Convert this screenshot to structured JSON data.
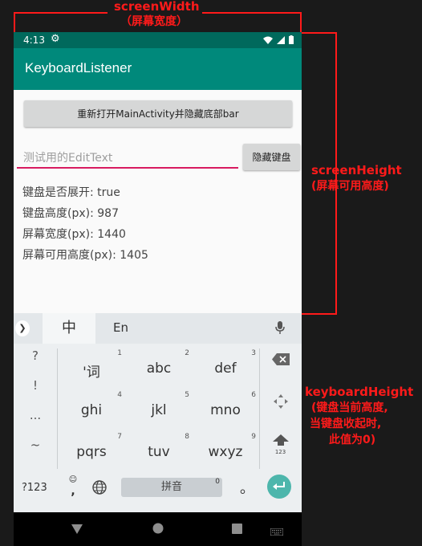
{
  "annotations": {
    "screen_width": [
      "screenWidth",
      "（屏幕宽度）"
    ],
    "screen_height": [
      "screenHeight",
      "(屏幕可用高度)"
    ],
    "keyboard_height": [
      "keyboardHeight",
      "(键盘当前高度,",
      "当键盘收起时,",
      "此值为0)"
    ]
  },
  "status_bar": {
    "time": "4:13"
  },
  "app_bar": {
    "title": "KeyboardListener"
  },
  "content": {
    "reopen_button": "重新打开MainActivity并隐藏底部bar",
    "edit_placeholder": "测试用的EditText",
    "hide_keyboard_button": "隐藏键盘",
    "info_lines": [
      "键盘是否展开: true",
      "键盘高度(px): 987",
      "屏幕宽度(px): 1440",
      "屏幕可用高度(px): 1405"
    ]
  },
  "keyboard": {
    "mode_zh": "中",
    "mode_en": "En",
    "left_symbols": [
      "?",
      "!",
      "...",
      "~"
    ],
    "keys": [
      {
        "num": "1",
        "label": "'词"
      },
      {
        "num": "2",
        "label": "abc"
      },
      {
        "num": "3",
        "label": "def"
      },
      {
        "num": "4",
        "label": "ghi"
      },
      {
        "num": "5",
        "label": "jkl"
      },
      {
        "num": "6",
        "label": "mno"
      },
      {
        "num": "7",
        "label": "pqrs"
      },
      {
        "num": "8",
        "label": "tuv"
      },
      {
        "num": "9",
        "label": "wxyz"
      }
    ],
    "shift_sub": "123",
    "bottom": {
      "symbols_key": "?123",
      "comma": ",",
      "space_label": "拼音",
      "space_num": "0",
      "period": "。"
    }
  },
  "colors": {
    "annotation": "#ff1a1a",
    "status_bar": "#00695c",
    "app_bar": "#00897b",
    "edit_underline": "#d81b60",
    "enter_key": "#4db6ac"
  }
}
